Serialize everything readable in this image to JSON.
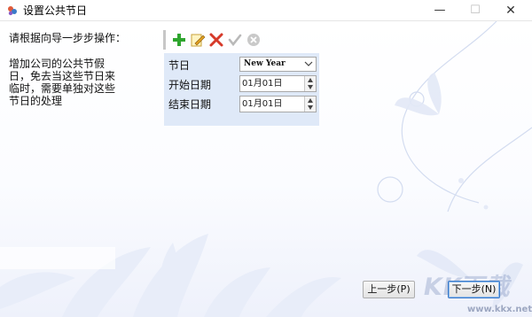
{
  "window": {
    "title": "设置公共节日",
    "minimize_glyph": "—",
    "maximize_glyph": "☐",
    "close_glyph": "✕"
  },
  "instructions": {
    "title": "请根据向导一步步操作：",
    "body": "增加公司的公共节假日，免去当这些节日来临时，需要单独对这些节日的处理"
  },
  "toolbar": {
    "icons": [
      "add-icon",
      "edit-icon",
      "delete-icon",
      "confirm-icon",
      "cancel-icon"
    ]
  },
  "form": {
    "holiday_label": "节日",
    "holiday_value": "New Year",
    "start_label": "开始日期",
    "start_value": "01月01日",
    "end_label": "结束日期",
    "end_value": "01月01日"
  },
  "footer": {
    "prev_label": "上一步(P)",
    "next_label": "下一步(N)"
  },
  "watermark": {
    "text": "KK下载",
    "url": "www.kkx.net"
  },
  "colors": {
    "panel_bg": "#dfe9f8",
    "add": "#2ea52e",
    "delete": "#d63a2a",
    "disabled": "#b9b9b9",
    "next_border": "#3a7ac8"
  }
}
